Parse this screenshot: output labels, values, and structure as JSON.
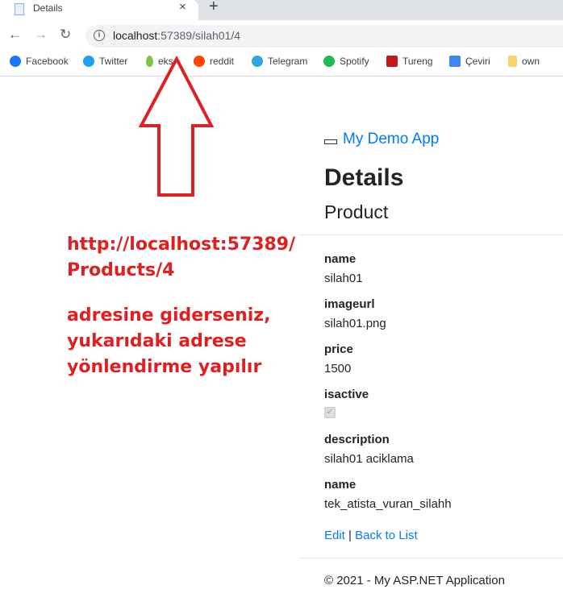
{
  "browser": {
    "tab_title": "Details",
    "tab_close": "×",
    "new_tab": "+",
    "url_host": "localhost",
    "url_rest": ":57389/silah01/4",
    "bookmarks": [
      {
        "label": "Facebook",
        "icon": "facebook-icon",
        "color": "#1877f2"
      },
      {
        "label": "Twitter",
        "icon": "twitter-icon",
        "color": "#1da1f2"
      },
      {
        "label": "eks",
        "icon": "drop-icon",
        "color": "#81c14b"
      },
      {
        "label": "reddit",
        "icon": "reddit-icon",
        "color": "#ff4500"
      },
      {
        "label": "Telegram",
        "icon": "telegram-icon",
        "color": "#2ca5e0"
      },
      {
        "label": "Spotify",
        "icon": "spotify-icon",
        "color": "#1db954"
      },
      {
        "label": "Tureng",
        "icon": "tureng-icon",
        "color": "#c4161c"
      },
      {
        "label": "Çeviri",
        "icon": "translate-icon",
        "color": "#4285f4"
      },
      {
        "label": "own",
        "icon": "folder-icon",
        "color": "#f9d36b"
      }
    ]
  },
  "annotation": {
    "line1": "http://localhost:57389/",
    "line2": "Products/4",
    "line3": "adresine giderseniz,",
    "line4": "yukarıdaki adrese",
    "line5": "yönlendirme yapılır",
    "color": "#e02020"
  },
  "app": {
    "brand": "My Demo App",
    "heading": "Details",
    "subheading": "Product",
    "fields": [
      {
        "label": "name",
        "value": "silah01"
      },
      {
        "label": "imageurl",
        "value": "silah01.png"
      },
      {
        "label": "price",
        "value": "1500"
      },
      {
        "label": "isactive",
        "value": "✓",
        "checked": true
      },
      {
        "label": "description",
        "value": "silah01 aciklama"
      },
      {
        "label": "name",
        "value": "tek_atista_vuran_silahh"
      }
    ],
    "edit_link": "Edit",
    "separator": "|",
    "back_link": "Back to List",
    "footer": "© 2021 - My ASP.NET Application",
    "link_color": "#007bff"
  }
}
